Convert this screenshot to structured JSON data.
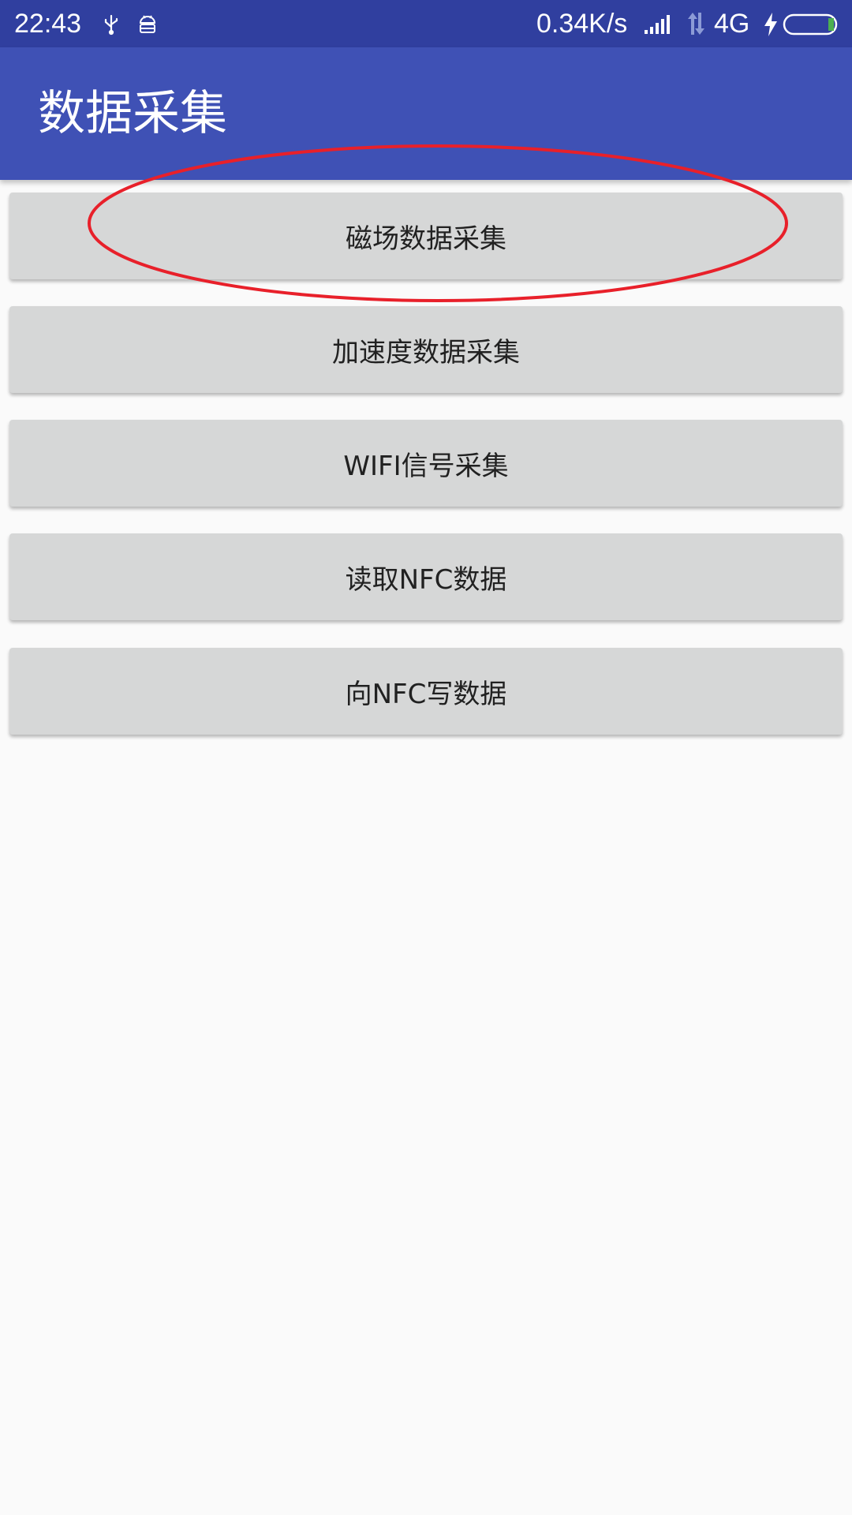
{
  "status_bar": {
    "time": "22:43",
    "net_speed": "0.34K/s",
    "network_type": "4G",
    "icons": [
      "usb-icon",
      "android-debug-icon",
      "signal-icon",
      "data-arrows-icon",
      "charging-icon",
      "battery-icon"
    ]
  },
  "app_bar": {
    "title": "数据采集"
  },
  "buttons": [
    {
      "label": "磁场数据采集"
    },
    {
      "label": "加速度数据采集"
    },
    {
      "label": "WIFI信号采集"
    },
    {
      "label": "读取NFC数据"
    },
    {
      "label": "向NFC写数据"
    }
  ],
  "annotation": {
    "color": "#e8202a",
    "shape": "ellipse",
    "target": "magnetic-data-button"
  },
  "colors": {
    "status_bar": "#303f9f",
    "app_bar": "#3f51b5",
    "button_bg": "#d6d7d7",
    "page_bg": "#fafafa",
    "battery_fill": "#4caf50"
  }
}
